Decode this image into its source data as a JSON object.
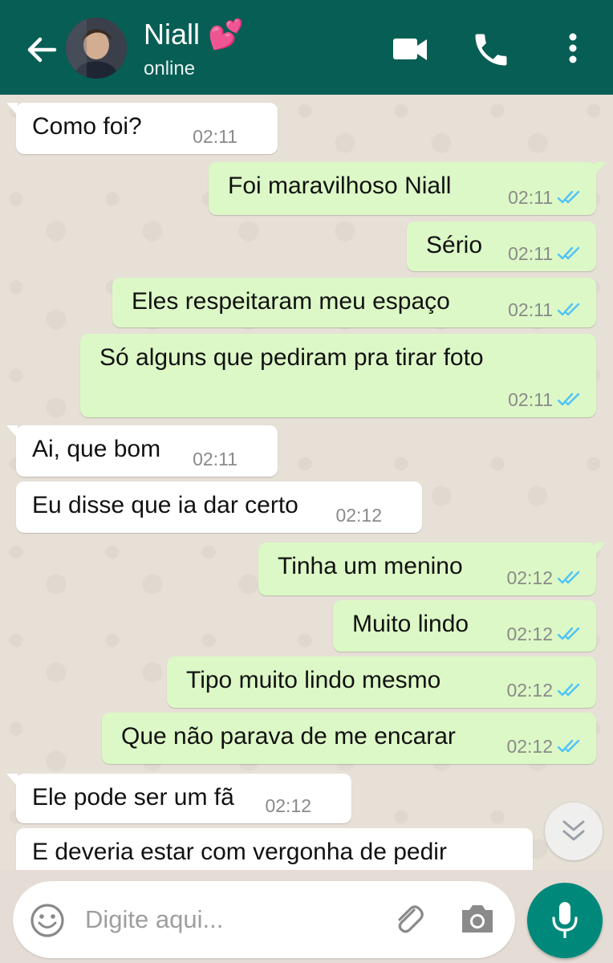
{
  "header": {
    "contact_name": "Niall 💕",
    "status": "online",
    "icons": [
      "back-arrow-icon",
      "video-call-icon",
      "phone-icon",
      "more-options-icon"
    ]
  },
  "messages": [
    {
      "side": "in",
      "text": "Como foi?",
      "time": "02:11",
      "tail": true
    },
    {
      "side": "out",
      "text": "Foi maravilhoso Niall",
      "time": "02:11",
      "tail": true,
      "read": true
    },
    {
      "side": "out",
      "text": "Sério",
      "time": "02:11",
      "read": true
    },
    {
      "side": "out",
      "text": "Eles respeitaram meu espaço",
      "time": "02:11",
      "read": true
    },
    {
      "side": "out",
      "text": "Só alguns que pediram pra tirar foto",
      "time": "02:11",
      "read": true
    },
    {
      "side": "in",
      "text": "Ai, que bom",
      "time": "02:11",
      "tail": true
    },
    {
      "side": "in",
      "text": "Eu disse que ia dar certo",
      "time": "02:12"
    },
    {
      "side": "out",
      "text": "Tinha um menino",
      "time": "02:12",
      "tail": true,
      "read": true
    },
    {
      "side": "out",
      "text": "Muito lindo",
      "time": "02:12",
      "read": true
    },
    {
      "side": "out",
      "text": "Tipo muito lindo mesmo",
      "time": "02:12",
      "read": true
    },
    {
      "side": "out",
      "text": "Que não parava de me encarar",
      "time": "02:12",
      "read": true
    },
    {
      "side": "in",
      "text": "Ele pode ser um fã",
      "time": "02:12",
      "tail": true
    },
    {
      "side": "in",
      "text": "E deveria estar com vergonha de pedir",
      "time": ""
    }
  ],
  "composer": {
    "placeholder": "Digite aqui...",
    "icons": [
      "emoji-icon",
      "attach-icon",
      "camera-icon",
      "mic-icon"
    ]
  },
  "colors": {
    "header": "#075e54",
    "outgoing_bubble": "#dcf8c6",
    "incoming_bubble": "#ffffff",
    "read_ticks": "#4fc3f7",
    "mic_button": "#00897b"
  }
}
